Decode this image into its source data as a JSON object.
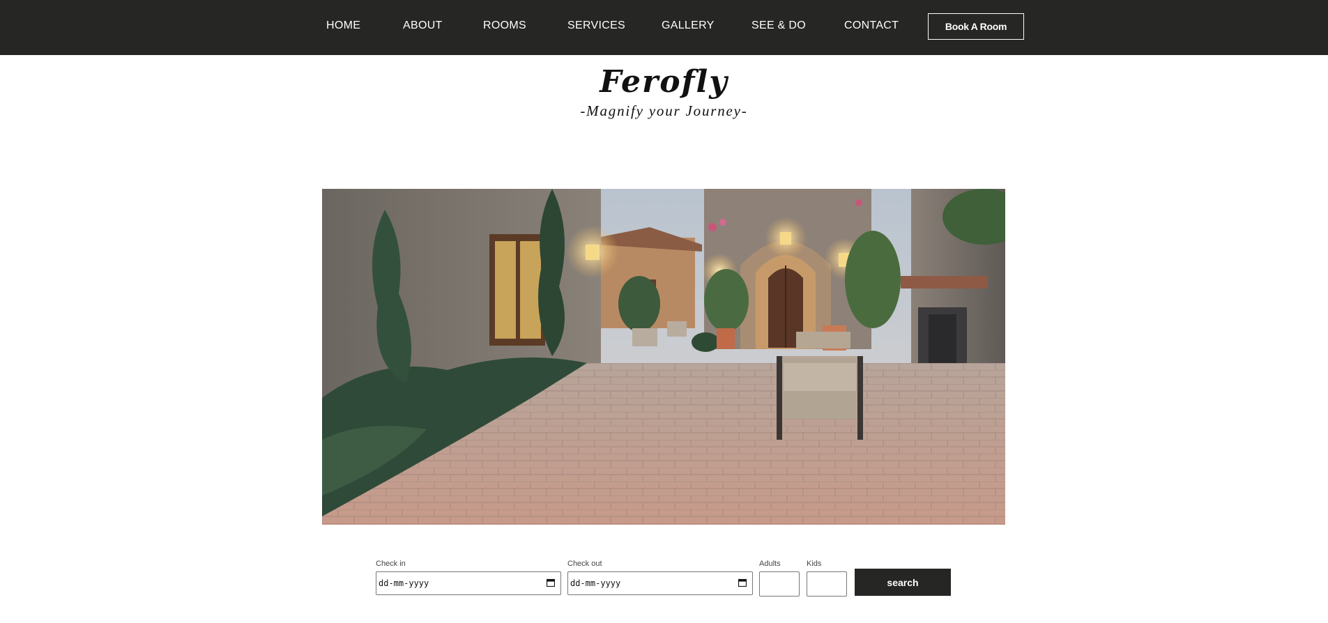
{
  "nav": {
    "items": [
      {
        "label": "HOME"
      },
      {
        "label": "ABOUT"
      },
      {
        "label": "ROOMS"
      },
      {
        "label": "SERVICES"
      },
      {
        "label": "GALLERY"
      },
      {
        "label": "SEE & DO"
      },
      {
        "label": "CONTACT"
      }
    ],
    "book_label": "Book A Room"
  },
  "brand": {
    "title": "Ferofly",
    "tagline": "-Magnify your Journey-"
  },
  "hero": {
    "image": "stone-villa-courtyard-photo"
  },
  "booking": {
    "check_in_label": "Check in",
    "check_in_value": "dd-mm-yyyy",
    "check_out_label": "Check out",
    "check_out_value": "dd-mm-yyyy",
    "adults_label": "Adults",
    "kids_label": "Kids",
    "search_label": "search"
  },
  "colors": {
    "nav_background": "#262624",
    "button_background": "#262624",
    "text_light": "#ffffff"
  }
}
